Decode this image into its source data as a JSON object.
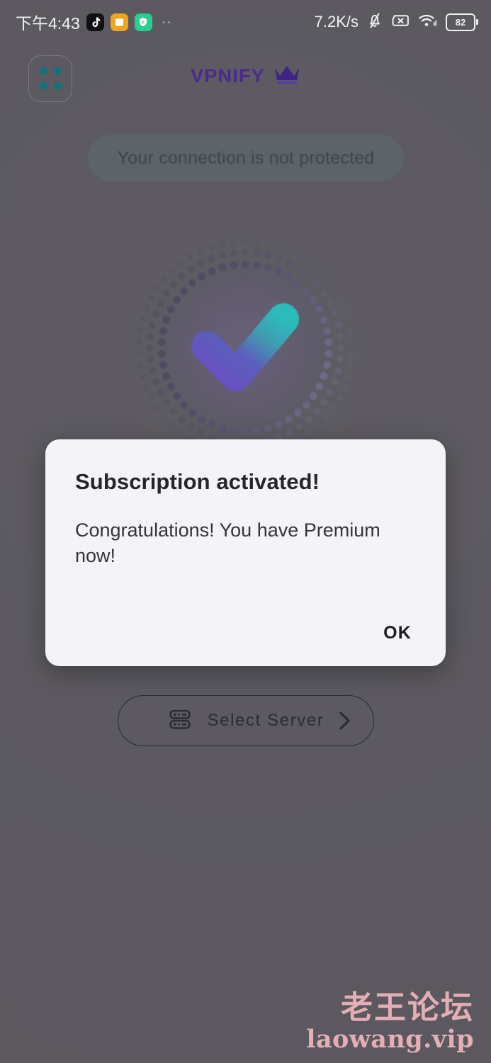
{
  "status_bar": {
    "time": "下午4:43",
    "app_icons": [
      {
        "name": "tiktok-icon",
        "color": "#0f0f14"
      },
      {
        "name": "notes-app-icon",
        "color": "#f0a521"
      },
      {
        "name": "security-app-icon",
        "color": "#29cf8e"
      }
    ],
    "overflow_indicator": "··",
    "network_speed": "7.2K/s",
    "icons": [
      "mute-bell-icon",
      "no-sim-icon",
      "wifi-icon"
    ],
    "battery_level": "82"
  },
  "app": {
    "brand_name": "VPNIFY",
    "brand_color": "#4a2a8f",
    "menu_icon": "grid-menu-icon",
    "menu_dot_color": "#15707c",
    "crown_icon": "crown-icon",
    "connection_status": "Your connection is not protected",
    "select_server_label": "Select Server",
    "server_icon": "server-rack-icon",
    "chevron_icon": "chevron-right-icon",
    "check_icon": "check-mark-icon"
  },
  "dialog": {
    "title": "Subscription activated!",
    "message": "Congratulations! You have Premium now!",
    "ok_label": "OK"
  },
  "watermark": {
    "title": "老王论坛",
    "url": "laowang.vip",
    "color": "#e3aeb4"
  }
}
